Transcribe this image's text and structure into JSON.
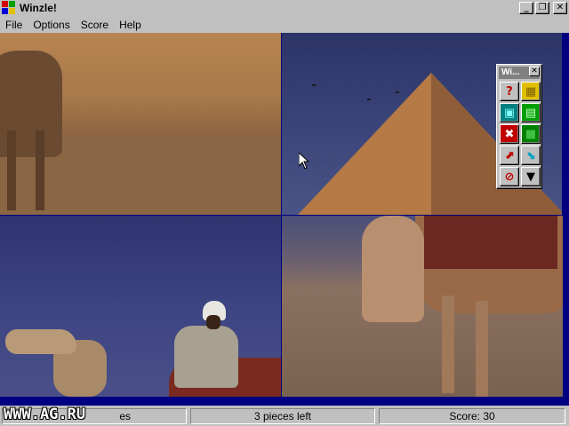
{
  "window": {
    "title": "Winzle!",
    "minimize_label": "_",
    "restore_label": "❐",
    "close_label": "✕"
  },
  "menu": {
    "items": [
      {
        "label": "File"
      },
      {
        "label": "Options"
      },
      {
        "label": "Score"
      },
      {
        "label": "Help"
      }
    ]
  },
  "toolbox": {
    "title": "Wi...",
    "close_label": "✕",
    "buttons": [
      {
        "icon": "help-icon",
        "glyph": "?",
        "color": "#c00000"
      },
      {
        "icon": "grid-icon",
        "glyph": "▦",
        "color": "#c0a000"
      },
      {
        "icon": "picture-icon",
        "glyph": "▣",
        "color": "#008080"
      },
      {
        "icon": "picture-swap-icon",
        "glyph": "▤",
        "color": "#008000"
      },
      {
        "icon": "stop-square-icon",
        "glyph": "✖",
        "color": "#c00000"
      },
      {
        "icon": "green-square-icon",
        "glyph": "■",
        "color": "#008000"
      },
      {
        "icon": "red-arrow-icon",
        "glyph": "⬈",
        "color": "#c00000"
      },
      {
        "icon": "cyan-arrow-icon",
        "glyph": "⬊",
        "color": "#00a0c0"
      },
      {
        "icon": "no-entry-icon",
        "glyph": "⊘",
        "color": "#c00000"
      },
      {
        "icon": "dropdown-arrow-icon",
        "glyph": "▼",
        "color": "#000000"
      }
    ]
  },
  "status": {
    "pane1": "es",
    "pane2": "3 pieces left",
    "pane3": "Score: 30"
  },
  "watermark": "WWW.AG.RU"
}
